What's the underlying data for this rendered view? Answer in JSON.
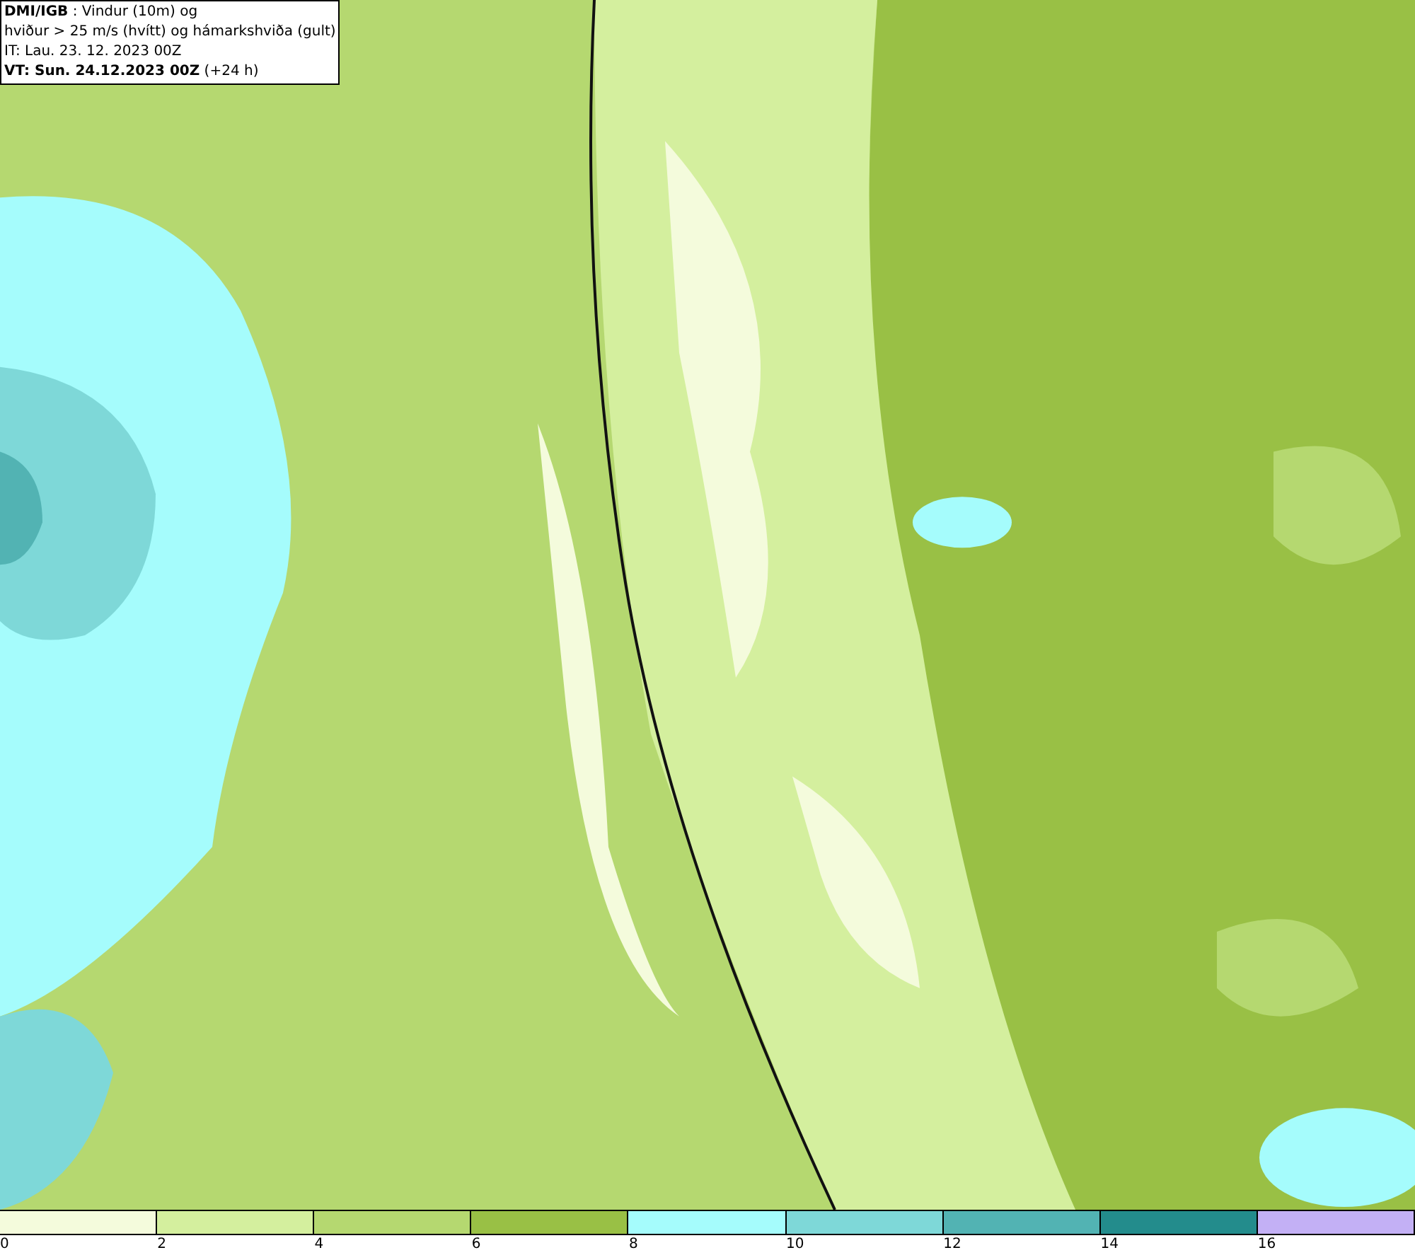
{
  "info_box": {
    "lines": [
      "**DMI/IGB** : Vindur (10m) og",
      "hviður > 25 m/s (hvítt) og hámarkshviða (gult)",
      "IT: Lau. 23. 12. 2023 00Z",
      "**VT: Sun. 24.12.2023 00Z** (+24 h)"
    ]
  },
  "legend": {
    "segments": [
      {
        "label": "0",
        "color": "#f4fbdc"
      },
      {
        "label": "2",
        "color": "#d4ef9e"
      },
      {
        "label": "4",
        "color": "#b5d870"
      },
      {
        "label": "6",
        "color": "#99c045"
      },
      {
        "label": "8",
        "color": "#a5fcfc"
      },
      {
        "label": "10",
        "color": "#7ed8d8"
      },
      {
        "label": "12",
        "color": "#52b3b3"
      },
      {
        "label": "14",
        "color": "#238c8c"
      },
      {
        "label": "16",
        "color": "#c3b0f5"
      }
    ]
  }
}
